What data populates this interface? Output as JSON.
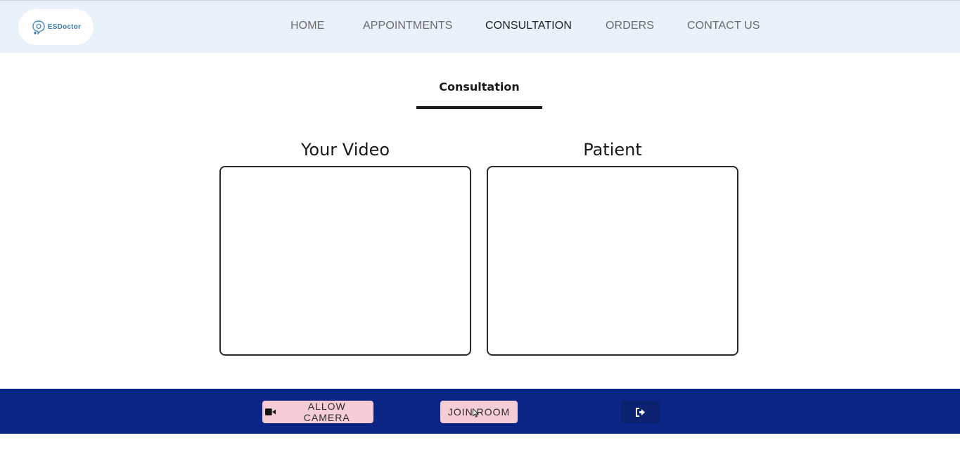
{
  "brand": {
    "name": "ESDoctor",
    "logo_icon": "stethoscope-speech-icon",
    "color": "#3a7cb5"
  },
  "nav": {
    "items": [
      {
        "label": "HOME"
      },
      {
        "label": "APPOINTMENTS"
      },
      {
        "label": "CONSULTATION"
      },
      {
        "label": "ORDERS"
      },
      {
        "label": "CONTACT US"
      }
    ],
    "active": "CONSULTATION"
  },
  "page": {
    "title": "Consultation"
  },
  "videos": {
    "local_label": "Your Video",
    "remote_label": "Patient"
  },
  "controls": {
    "allow_camera_label": "ALLOW CAMERA",
    "camera_icon": "video-camera-icon",
    "join_room_label": "JOIN ROOM",
    "leave_icon": "sign-out-icon",
    "bar_color": "#0a2585",
    "button_color": "#f6cdd4"
  }
}
